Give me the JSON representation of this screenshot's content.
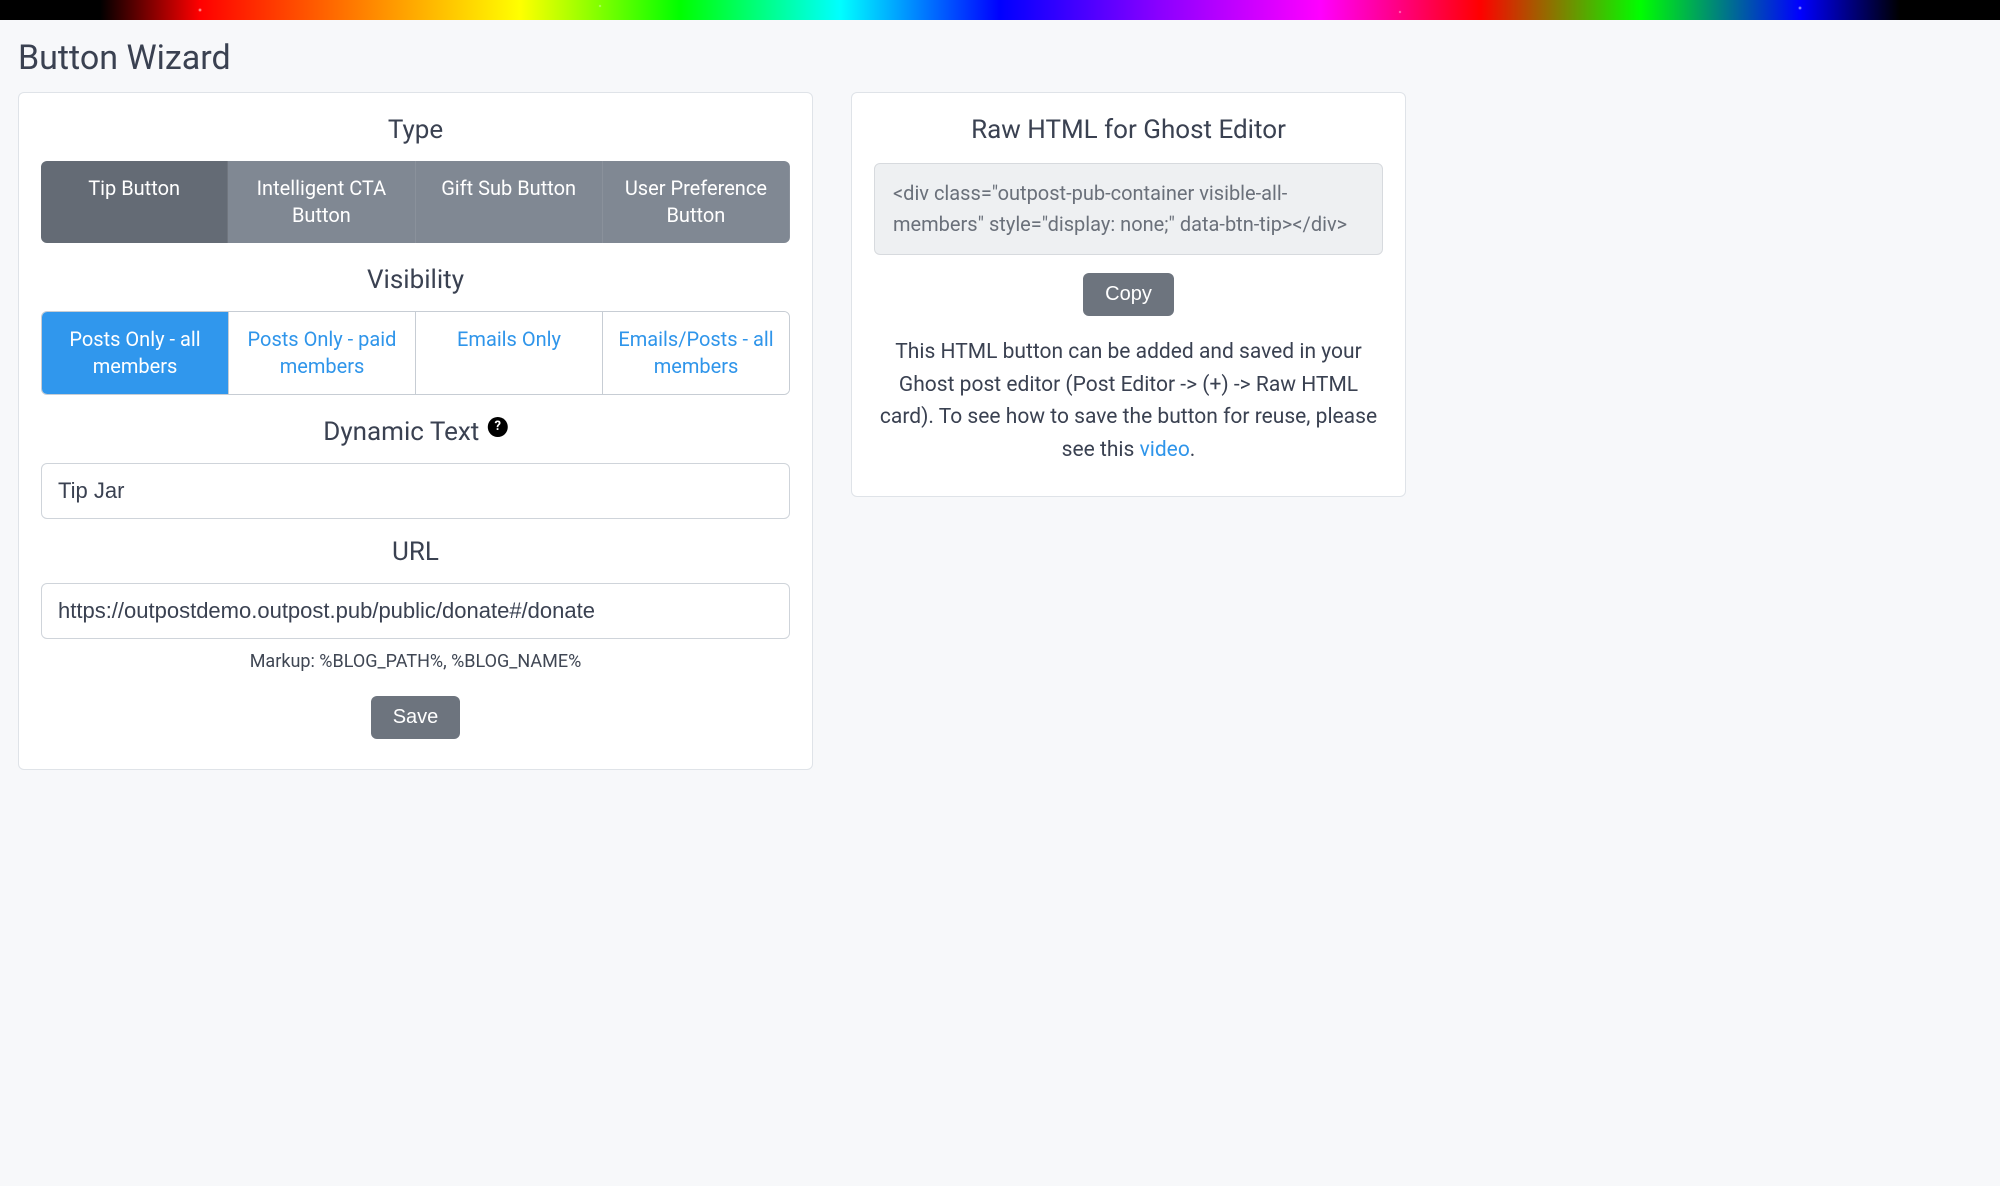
{
  "page_title": "Button Wizard",
  "sections": {
    "type": {
      "heading": "Type",
      "options": [
        "Tip Button",
        "Intelligent CTA Button",
        "Gift Sub Button",
        "User Preference Button"
      ],
      "active_index": 0
    },
    "visibility": {
      "heading": "Visibility",
      "options": [
        "Posts Only - all members",
        "Posts Only - paid members",
        "Emails Only",
        "Emails/Posts - all members"
      ],
      "active_index": 0
    },
    "dynamic_text": {
      "heading": "Dynamic Text",
      "help_glyph": "?",
      "value": "Tip Jar"
    },
    "url": {
      "heading": "URL",
      "value": "https://outpostdemo.outpost.pub/public/donate#/donate",
      "hint": "Markup: %BLOG_PATH%, %BLOG_NAME%"
    },
    "save_label": "Save"
  },
  "right": {
    "heading": "Raw HTML for Ghost Editor",
    "code": "<div class=\"outpost-pub-container visible-all-members\" style=\"display: none;\" data-btn-tip></div>",
    "copy_label": "Copy",
    "description_pre": "This HTML button can be added and saved in your Ghost post editor (Post Editor -> (+) -> Raw HTML card). To see how to save the button for reuse, please see this ",
    "description_link": "video",
    "description_post": "."
  }
}
